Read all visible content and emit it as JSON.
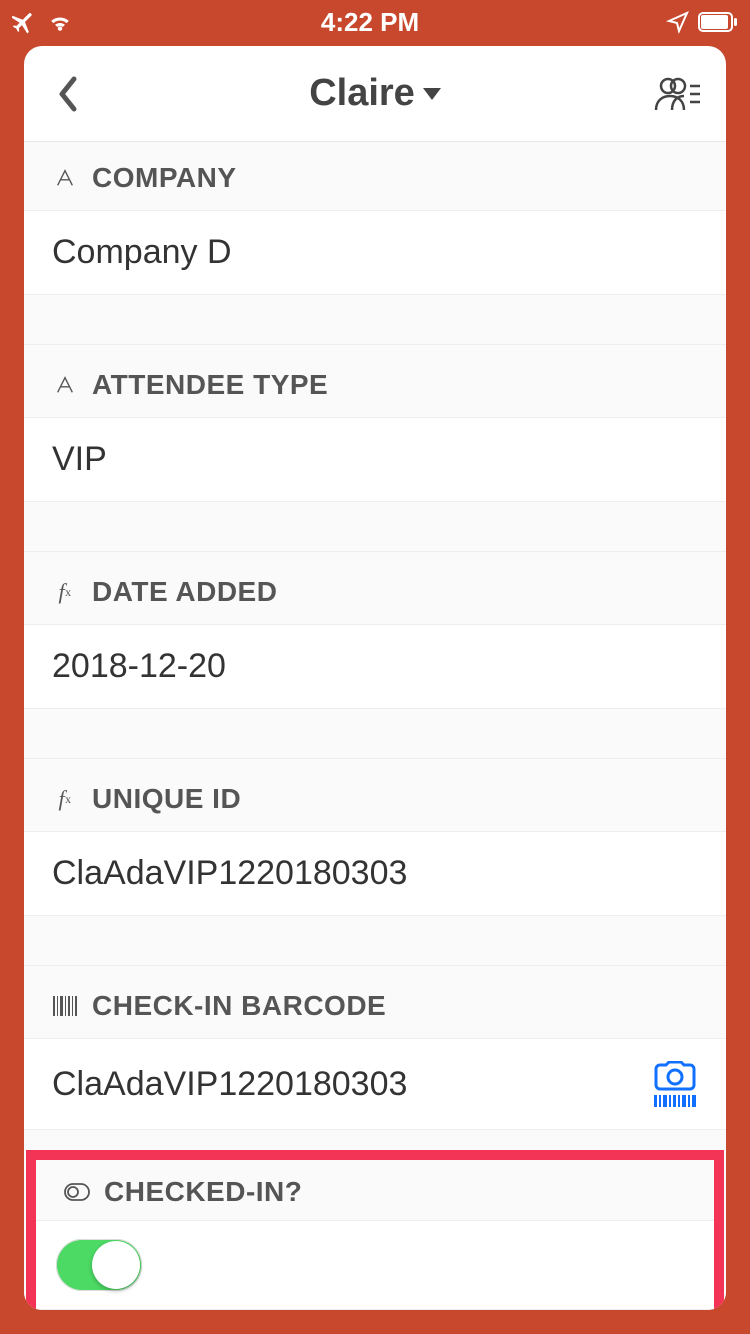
{
  "status": {
    "time": "4:22 PM"
  },
  "nav": {
    "title": "Claire"
  },
  "fields": {
    "company": {
      "label": "COMPANY",
      "value": "Company D"
    },
    "attendee_type": {
      "label": "ATTENDEE TYPE",
      "value": "VIP"
    },
    "date_added": {
      "label": "DATE ADDED",
      "value": "2018-12-20"
    },
    "unique_id": {
      "label": "UNIQUE ID",
      "value": "ClaAdaVIP1220180303"
    },
    "barcode": {
      "label": "CHECK-IN BARCODE",
      "value": "ClaAdaVIP1220180303"
    },
    "checked_in": {
      "label": "CHECKED-IN?",
      "value": true
    }
  }
}
